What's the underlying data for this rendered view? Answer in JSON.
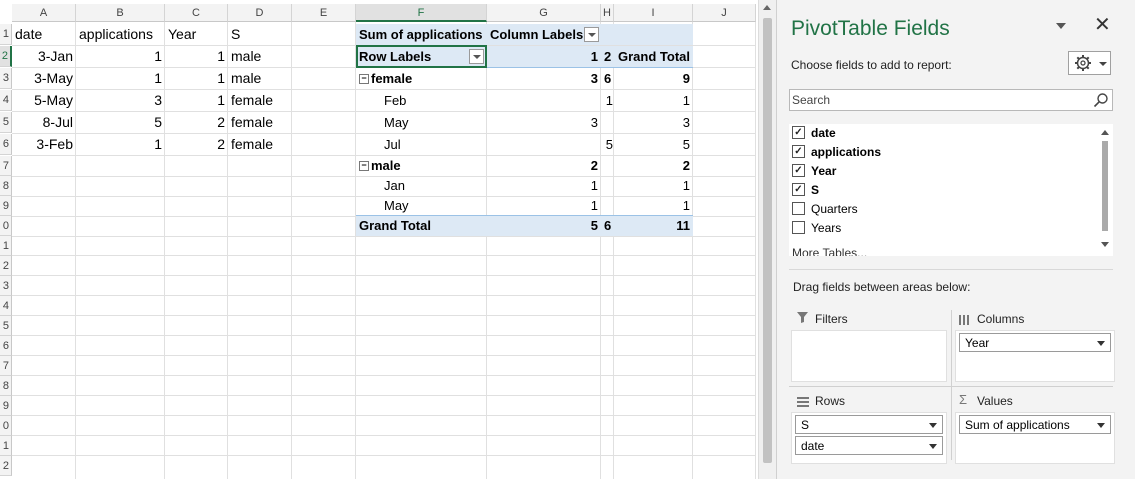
{
  "columns": [
    "A",
    "B",
    "C",
    "D",
    "E",
    "F",
    "G",
    "H",
    "I",
    "J"
  ],
  "rows": [
    "1",
    "2",
    "3",
    "4",
    "5",
    "6",
    "7",
    "8",
    "9",
    "0",
    "1",
    "2",
    "3",
    "4",
    "5",
    "6",
    "7",
    "8",
    "9",
    "0",
    "1",
    "2"
  ],
  "source": {
    "headers": [
      "date",
      "applications",
      "Year",
      "S"
    ],
    "data": [
      [
        "3-Jan",
        "1",
        "1",
        "male"
      ],
      [
        "3-May",
        "1",
        "1",
        "male"
      ],
      [
        "5-May",
        "3",
        "1",
        "female"
      ],
      [
        "8-Jul",
        "5",
        "2",
        "female"
      ],
      [
        "3-Feb",
        "1",
        "2",
        "female"
      ]
    ]
  },
  "pivot": {
    "value_title": "Sum of applications",
    "column_labels": "Column Labels",
    "row_labels": "Row Labels",
    "col_keys": [
      "1",
      "2"
    ],
    "grand_total": "Grand Total",
    "collapse_glyph": "−",
    "rows": [
      {
        "label": "female",
        "v1": "3",
        "v2": "6",
        "gt": "9"
      },
      {
        "label": "Feb",
        "v1": "",
        "v2": "1",
        "gt": "1"
      },
      {
        "label": "May",
        "v1": "3",
        "v2": "",
        "gt": "3"
      },
      {
        "label": "Jul",
        "v1": "",
        "v2": "5",
        "gt": "5"
      },
      {
        "label": "male",
        "v1": "2",
        "v2": "",
        "gt": "2"
      },
      {
        "label": "Jan",
        "v1": "1",
        "v2": "",
        "gt": "1"
      },
      {
        "label": "May",
        "v1": "1",
        "v2": "",
        "gt": "1"
      }
    ],
    "totals": {
      "v1": "5",
      "v2": "6",
      "gt": "11"
    }
  },
  "pane": {
    "title": "PivotTable Fields",
    "choose_label": "Choose fields to add to report:",
    "search_placeholder": "Search",
    "fields": [
      {
        "name": "date",
        "checked": true
      },
      {
        "name": "applications",
        "checked": true
      },
      {
        "name": "Year",
        "checked": true
      },
      {
        "name": "S",
        "checked": true
      },
      {
        "name": "Quarters",
        "checked": false
      },
      {
        "name": "Years",
        "checked": false
      }
    ],
    "more_tables": "More Tables...",
    "drag_label": "Drag fields between areas below:",
    "areas": {
      "filters": "Filters",
      "columns": "Columns",
      "rows": "Rows",
      "values": "Values",
      "columns_fields": [
        "Year"
      ],
      "rows_fields": [
        "S",
        "date"
      ],
      "values_fields": [
        "Sum of applications"
      ]
    },
    "check_glyph": "✓",
    "icons": [
      "gear-icon",
      "search-icon",
      "close-icon",
      "filter-icon",
      "columns-icon",
      "rows-icon",
      "sigma-icon"
    ]
  },
  "colors": {
    "accent": "#217346",
    "pivot_header": "#dde9f5"
  }
}
